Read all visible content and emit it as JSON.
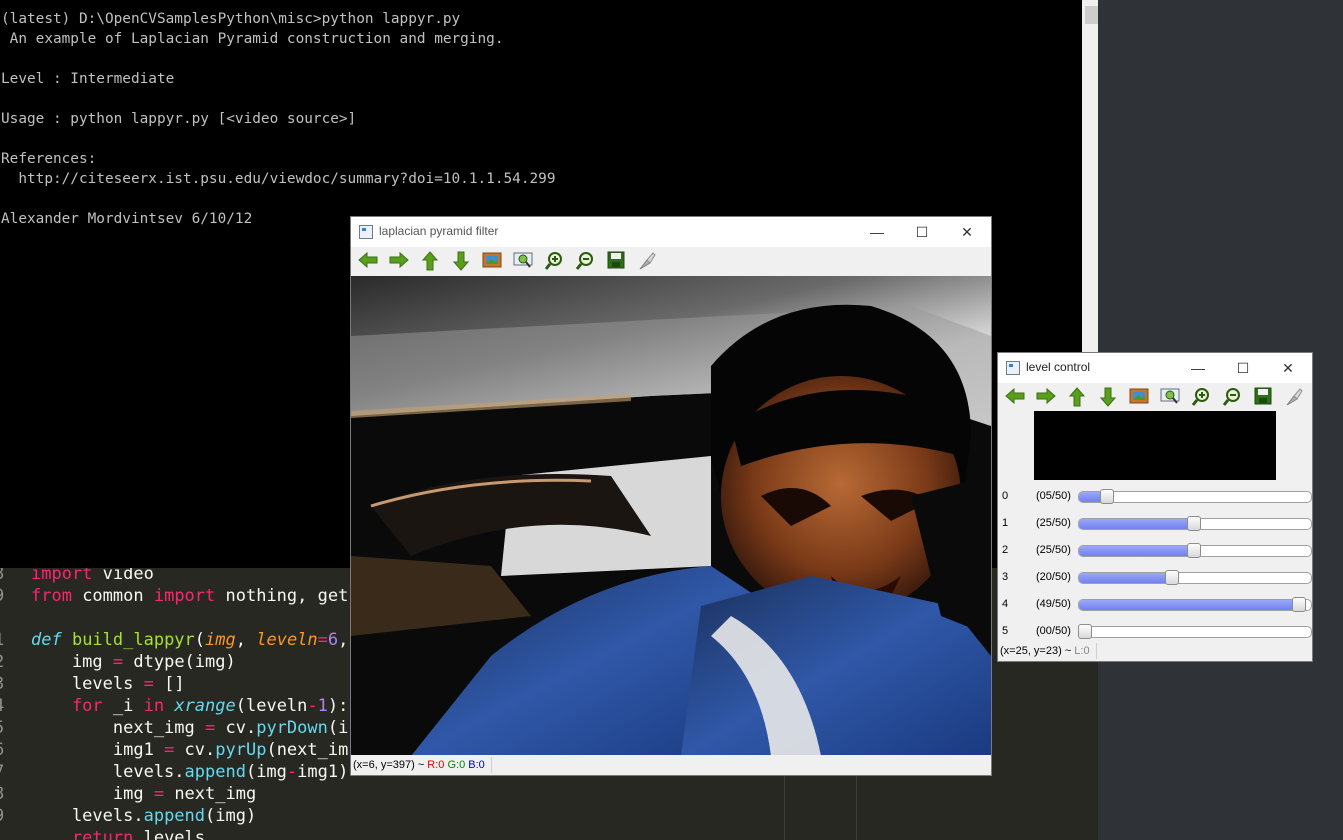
{
  "console": {
    "lines": [
      "(latest) D:\\OpenCVSamplesPython\\misc>python lappyr.py",
      " An example of Laplacian Pyramid construction and merging.",
      "",
      "Level : Intermediate",
      "",
      "Usage : python lappyr.py [<video source>]",
      "",
      "References:",
      "  http://citeseerx.ist.psu.edu/viewdoc/summary?doi=10.1.1.54.299",
      "",
      "Alexander Mordvintsev 6/10/12"
    ]
  },
  "editor": {
    "line_numbers": [
      "8",
      "9",
      "",
      "1",
      "2",
      "3",
      "4",
      "5",
      "6",
      "7",
      "8",
      "9",
      ""
    ],
    "snippets": {
      "l1_kw": "import",
      "l1_rest": " video",
      "l2_kw1": "from",
      "l2_mod": " common ",
      "l2_kw2": "import",
      "l2_rest": " nothing, get",
      "l4_def": "def",
      "l4_fn": " build_lappyr",
      "l4_p1": "(",
      "l4_a1": "img",
      "l4_p2": ", ",
      "l4_a2": "leveln",
      "l4_eq": "=",
      "l4_num": "6",
      "l4_p3": ",",
      "l5_a": "    img ",
      "l5_eq": "=",
      "l5_rest": " dtype(img)",
      "l6_a": "    levels ",
      "l6_eq": "=",
      "l6_rest": " []",
      "l7_for": "    for",
      "l7_i": " _i ",
      "l7_in": "in",
      "l7_xr": " xrange",
      "l7_p": "(leveln",
      "l7_minus": "-",
      "l7_num": "1",
      "l7_end": "):",
      "l8_a": "        next_img ",
      "l8_eq": "=",
      "l8_cv": " cv.",
      "l8_fn": "pyrDown",
      "l8_rest": "(i",
      "l9_a": "        img1 ",
      "l9_eq": "=",
      "l9_cv": " cv.",
      "l9_fn": "pyrUp",
      "l9_rest": "(next_im",
      "l10_a": "        levels.",
      "l10_fn": "append",
      "l10_rest1": "(img",
      "l10_minus": "-",
      "l10_rest2": "img1)",
      "l11_a": "        img ",
      "l11_eq": "=",
      "l11_rest": " next_img",
      "l12_a": "    levels.",
      "l12_fn": "append",
      "l12_rest": "(img)",
      "l13_kw": "    return",
      "l13_rest": " levels"
    }
  },
  "filter_window": {
    "title": "laplacian pyramid filter",
    "status": {
      "coords": "(x=6, y=397) ~ ",
      "r": "R:0",
      "g": "G:0",
      "b": "B:0"
    }
  },
  "level_window": {
    "title": "level control",
    "status": {
      "coords": "(x=25, y=23) ~ ",
      "l": "L:0"
    },
    "sliders": [
      {
        "index": "0",
        "label": "(05/50)",
        "value": 5,
        "max": 50
      },
      {
        "index": "1",
        "label": "(25/50)",
        "value": 25,
        "max": 50
      },
      {
        "index": "2",
        "label": "(25/50)",
        "value": 25,
        "max": 50
      },
      {
        "index": "3",
        "label": "(20/50)",
        "value": 20,
        "max": 50
      },
      {
        "index": "4",
        "label": "(49/50)",
        "value": 49,
        "max": 50
      },
      {
        "index": "5",
        "label": "(00/50)",
        "value": 0,
        "max": 50
      }
    ]
  },
  "window_controls": {
    "minimize": "—",
    "maximize": "☐",
    "close": "✕"
  },
  "toolbar_icons": [
    "arrow-left-icon",
    "arrow-right-icon",
    "arrow-up-icon",
    "arrow-down-icon",
    "image-icon",
    "zoom-fit-icon",
    "zoom-in-icon",
    "zoom-out-icon",
    "save-icon",
    "properties-icon"
  ]
}
